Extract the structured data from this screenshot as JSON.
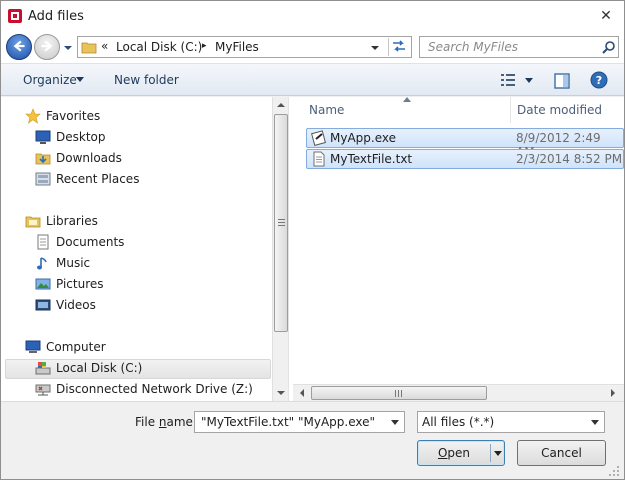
{
  "window": {
    "title": "Add files"
  },
  "address": {
    "overflow_glyph": "«",
    "crumbs": [
      "Local Disk (C:)",
      "MyFiles"
    ],
    "separator": "▸"
  },
  "search": {
    "placeholder": "Search MyFiles"
  },
  "toolbar": {
    "organize_label": "Organize",
    "new_folder_label": "New folder"
  },
  "nav": {
    "groups": [
      {
        "label": "Favorites",
        "icon": "star-icon",
        "items": [
          {
            "label": "Desktop",
            "icon": "desktop-icon"
          },
          {
            "label": "Downloads",
            "icon": "downloads-icon"
          },
          {
            "label": "Recent Places",
            "icon": "recent-places-icon"
          }
        ]
      },
      {
        "label": "Libraries",
        "icon": "libraries-icon",
        "items": [
          {
            "label": "Documents",
            "icon": "documents-icon"
          },
          {
            "label": "Music",
            "icon": "music-icon"
          },
          {
            "label": "Pictures",
            "icon": "pictures-icon"
          },
          {
            "label": "Videos",
            "icon": "videos-icon"
          }
        ]
      },
      {
        "label": "Computer",
        "icon": "computer-icon",
        "items": [
          {
            "label": "Local Disk (C:)",
            "icon": "drive-icon",
            "selected": true
          },
          {
            "label": "Disconnected Network Drive (Z:)",
            "icon": "network-drive-icon"
          }
        ]
      }
    ]
  },
  "files": {
    "columns": {
      "name": "Name",
      "date": "Date modified"
    },
    "rows": [
      {
        "name": "MyApp.exe",
        "date": "8/9/2012 2:49 AM",
        "icon": "exe-icon",
        "selected": true
      },
      {
        "name": "MyTextFile.txt",
        "date": "2/3/2014 8:52 PM",
        "icon": "text-file-icon",
        "selected": true
      }
    ]
  },
  "bottom": {
    "file_name_label_pre": "File ",
    "file_name_label_u": "n",
    "file_name_label_post": "ame:",
    "file_name_value": "\"MyTextFile.txt\" \"MyApp.exe\"",
    "file_type_value": "All files (*.*)",
    "open_label_u": "O",
    "open_label_post": "pen",
    "cancel_label": "Cancel"
  },
  "colors": {
    "accent": "#3c7fb1",
    "selection": "#cfe3fb",
    "selection_border": "#84acdd"
  }
}
